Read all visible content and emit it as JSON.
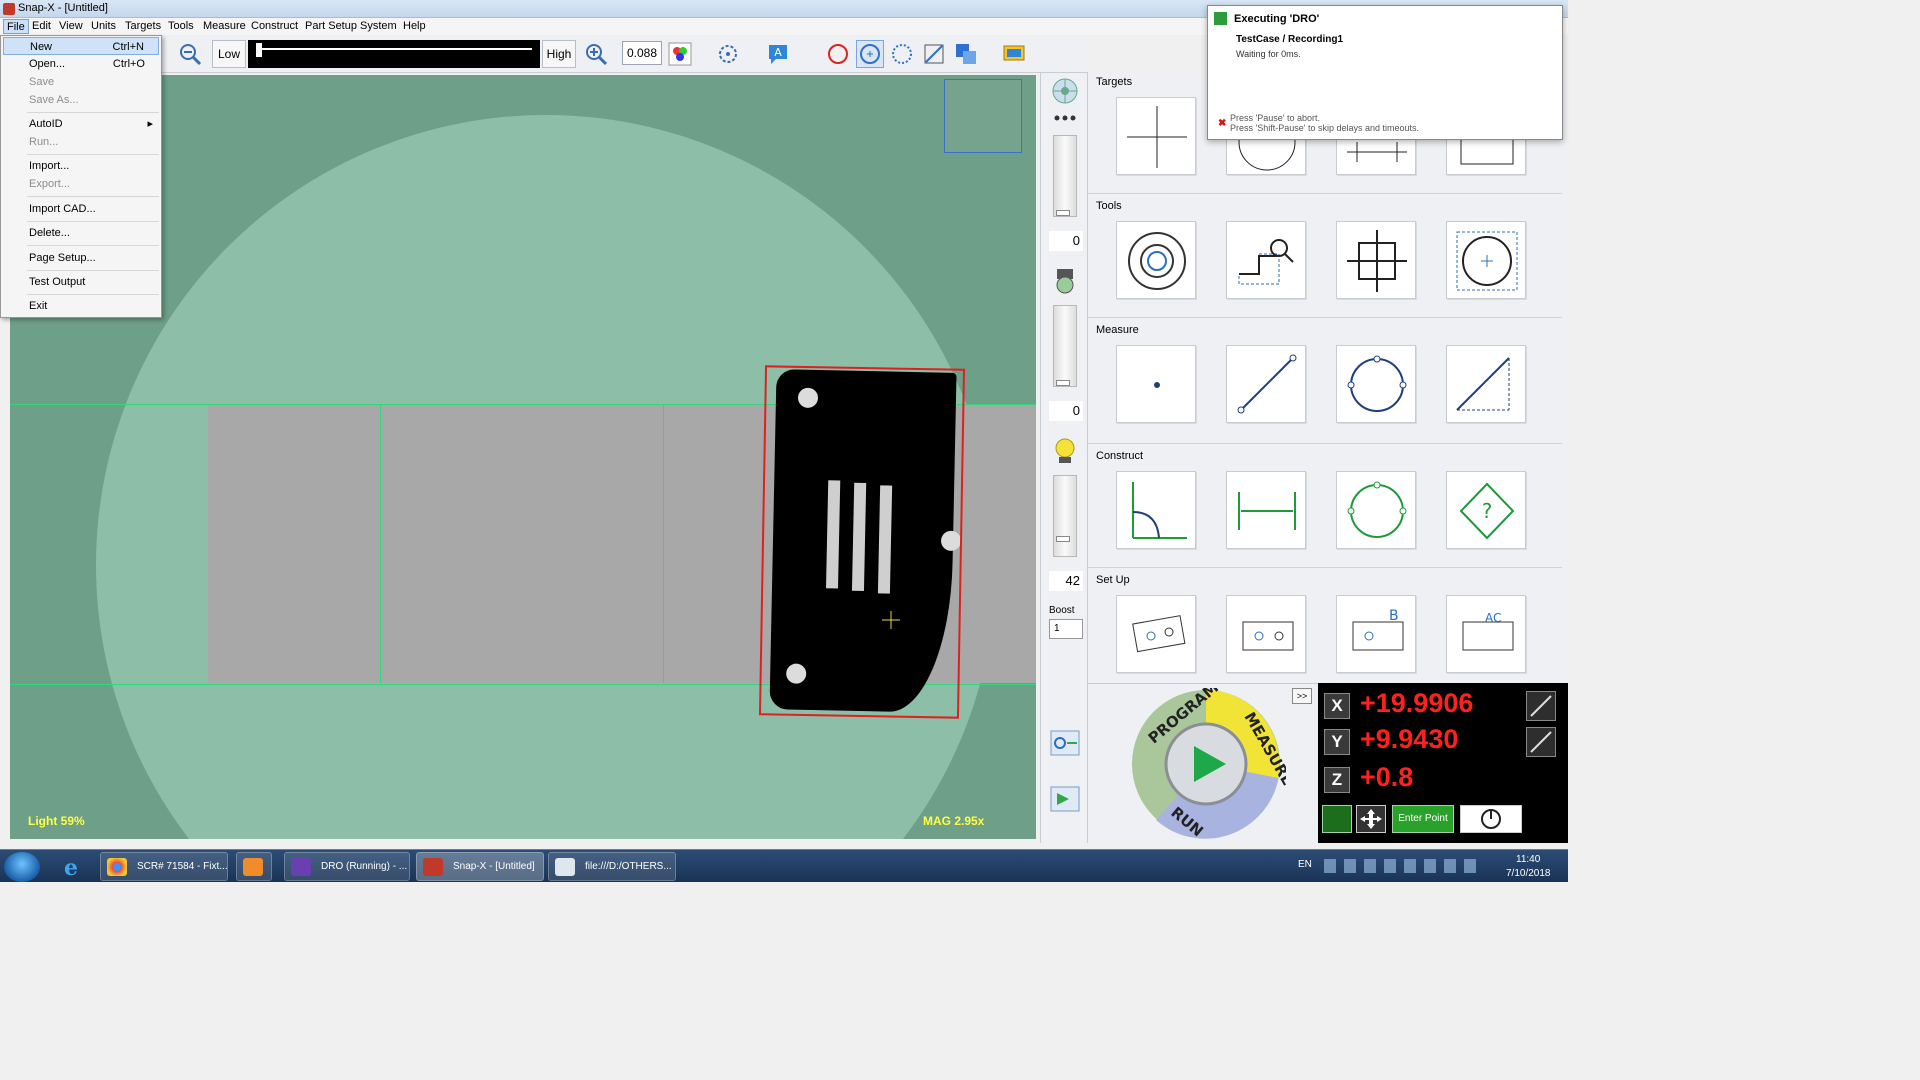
{
  "window": {
    "title": "Snap-X - [Untitled]"
  },
  "menubar": {
    "items": [
      "File",
      "Edit",
      "View",
      "Units",
      "Targets",
      "Tools",
      "Measure",
      "Construct",
      "Part Setup",
      "System",
      "Help"
    ]
  },
  "toolbar": {
    "low_label": "Low",
    "high_label": "High",
    "zoom_value": "0.088"
  },
  "file_menu": {
    "new": "New",
    "new_shortcut": "Ctrl+N",
    "open": "Open...",
    "open_shortcut": "Ctrl+O",
    "save": "Save",
    "save_as": "Save As...",
    "autoid": "AutoID",
    "run": "Run...",
    "import": "Import...",
    "export": "Export...",
    "import_cad": "Import CAD...",
    "delete": "Delete...",
    "page_setup": "Page Setup...",
    "test_output": "Test Output",
    "exit": "Exit"
  },
  "viewport": {
    "light_label": "Light  59%",
    "mag_label": "MAG 2.95x"
  },
  "sidebar": {
    "slider1_value": "0",
    "slider2_value": "0",
    "slider3_value": "42",
    "boost_label": "Boost",
    "boost_value": "1"
  },
  "panel": {
    "targets_label": "Targets",
    "tools_label": "Tools",
    "measure_label": "Measure",
    "construct_label": "Construct",
    "setup_label": "Set Up"
  },
  "dial": {
    "program": "PROGRAM",
    "measure": "MEASURE",
    "run": "RUN",
    "expand": ">>"
  },
  "dro": {
    "x_axis": "X",
    "y_axis": "Y",
    "z_axis": "Z",
    "x_value": "+19.9906",
    "y_value": "+9.9430",
    "z_value": "+0.8",
    "enter_point": "Enter Point"
  },
  "notification": {
    "title": "Executing 'DRO'",
    "step": "TestCase / Recording1",
    "waiting": "Waiting for 0ms.",
    "abort_line1": "Press 'Pause' to abort.",
    "abort_line2": "Press 'Shift-Pause' to skip delays and timeouts."
  },
  "taskbar": {
    "tasks": [
      "SCR# 71584 - Fixt...",
      "DRO (Running) - ...",
      "Snap-X - [Untitled]",
      "file:///D:/OTHERS..."
    ],
    "lang": "EN",
    "time": "11:40",
    "date": "7/10/2018"
  },
  "colors": {
    "viewport_bg": "#6e9f88",
    "fov": "#8dbfa8",
    "dro_red": "#ff2020",
    "accent_green": "#34d67a"
  }
}
